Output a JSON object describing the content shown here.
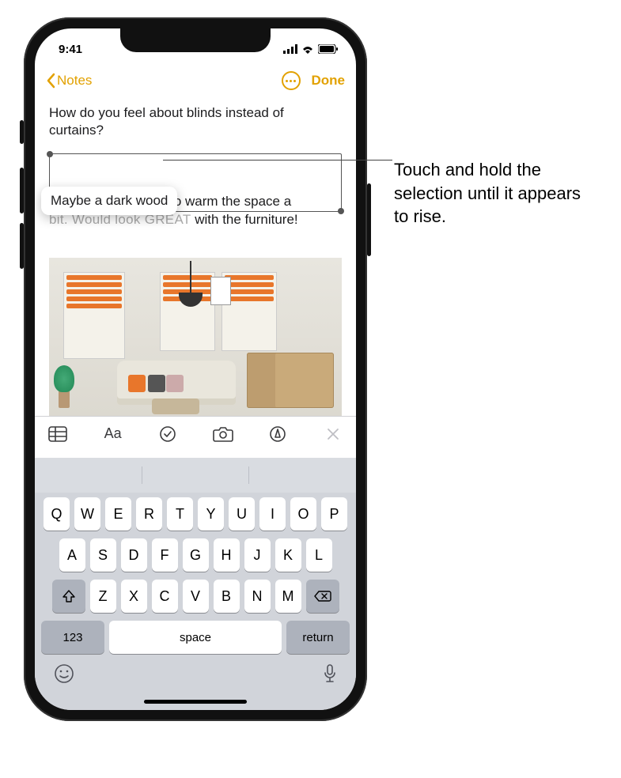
{
  "status": {
    "time": "9:41"
  },
  "nav": {
    "back_label": "Notes",
    "done_label": "Done"
  },
  "note": {
    "line1": "How do you feel about blinds instead of curtains?",
    "floating_selection": "Maybe a dark wood",
    "under_visible_tail": "o warm the space a",
    "under_blur": "bit. Would look GREAT",
    "under_tail2": " with the furniture!"
  },
  "annotation": "Touch and hold the selection until it appears to rise.",
  "toolbar": {
    "table": "table-icon",
    "format_label": "Aa",
    "checklist": "checklist-icon",
    "camera": "camera-icon",
    "markup": "markup-icon",
    "close": "close-icon"
  },
  "keyboard": {
    "row1": [
      "Q",
      "W",
      "E",
      "R",
      "T",
      "Y",
      "U",
      "I",
      "O",
      "P"
    ],
    "row2": [
      "A",
      "S",
      "D",
      "F",
      "G",
      "H",
      "J",
      "K",
      "L"
    ],
    "row3": [
      "Z",
      "X",
      "C",
      "V",
      "B",
      "N",
      "M"
    ],
    "num_label": "123",
    "space_label": "space",
    "return_label": "return"
  }
}
